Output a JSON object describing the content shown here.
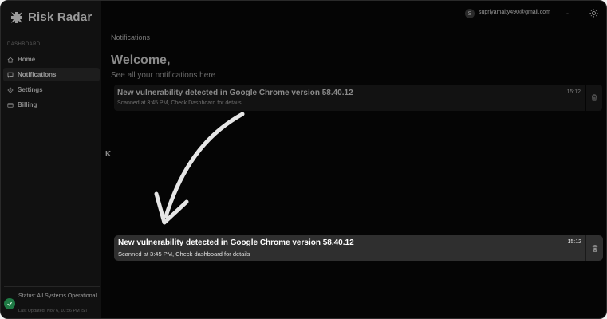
{
  "app": {
    "name": "Risk Radar",
    "logo_icon": "cross-logo-icon"
  },
  "sidebar": {
    "section_label": "DASHBOARD",
    "items": [
      {
        "label": "Home",
        "icon": "home-icon",
        "active": false
      },
      {
        "label": "Notifications",
        "icon": "chat-icon",
        "active": true
      },
      {
        "label": "Settings",
        "icon": "gear-icon",
        "active": false
      },
      {
        "label": "Billing",
        "icon": "card-icon",
        "active": false
      }
    ],
    "status": {
      "text": "Status: All Systems Operational",
      "updated": "Last Updated: Nov 6, 10:56 PM IST",
      "color": "#1f7a45"
    },
    "collapse_glyph": "K"
  },
  "topbar": {
    "avatar_letter": "S",
    "email": "supriyamaity490@gmail.com",
    "chevron": "⌄"
  },
  "page": {
    "breadcrumb": "Notifications",
    "welcome": "Welcome,",
    "subtitle": "See all your notifications here"
  },
  "notification_dim": {
    "title": "New vulnerability detected in Google Chrome version 58.40.12",
    "detail": "Scanned at 3:45 PM, Check Dashboard for details",
    "time": "15:12"
  },
  "notification_highlight": {
    "title": "New vulnerability detected in Google Chrome version 58.40.12",
    "detail": "Scanned at 3:45 PM, Check dashboard for details",
    "time": "15:12"
  }
}
